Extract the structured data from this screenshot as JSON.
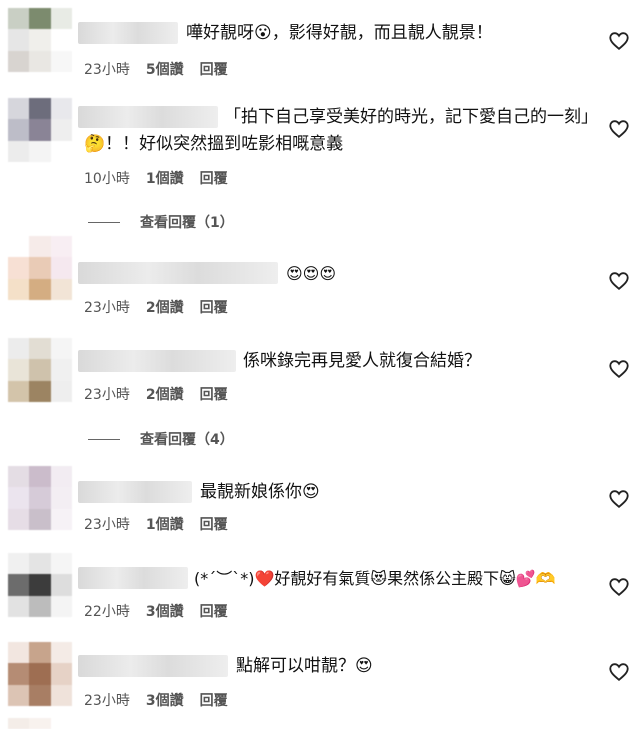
{
  "comments": [
    {
      "text": "嘩好靚呀😮，影得好靚，而且靚人靚景！",
      "time": "23小時",
      "likes": "5個讚",
      "reply": "回覆",
      "avatar": [
        "#c9cfc4",
        "#7c8b6e",
        "#e8ebe5",
        "#e6e6e6",
        "#f0efeb",
        "#ffffff",
        "#d8d4d0",
        "#e9e7e3",
        "#f7f7f7"
      ]
    },
    {
      "text": "「拍下自己享受美好的時光，記下愛自己的一刻」🤔！！好似突然搵到咗影相嘅意義",
      "time": "10小時",
      "likes": "1個讚",
      "reply": "回覆",
      "avatar": [
        "#d6d6dc",
        "#6d6d7c",
        "#e8e8ec",
        "#bdbdc8",
        "#8a8496",
        "#eeeeee",
        "#ececec",
        "#f4f4f4",
        "#ffffff"
      ]
    },
    {
      "text": "😍😍😍",
      "time": "23小時",
      "likes": "2個讚",
      "reply": "回覆",
      "avatar": [
        "#ffffff",
        "#f6ebe9",
        "#f8eef3",
        "#f7e0d4",
        "#e9cbb6",
        "#f5e8ef",
        "#f4e0c8",
        "#d4ad82",
        "#f2e4d6"
      ]
    },
    {
      "text": "係咪錄完再見愛人就復合結婚？",
      "time": "23小時",
      "likes": "2個讚",
      "reply": "回覆",
      "avatar": [
        "#ececec",
        "#e2ddd3",
        "#f5f5f5",
        "#e9e4d8",
        "#cfc2ac",
        "#f0f0f0",
        "#d3c4aa",
        "#9c8462",
        "#eeeeee"
      ]
    },
    {
      "text": "最靚新娘係你😍",
      "time": "23小時",
      "likes": "1個讚",
      "reply": "回覆",
      "avatar": [
        "#e4dde4",
        "#cbbccb",
        "#f2ecf2",
        "#ebe4ee",
        "#d6cbd8",
        "#f3eef3",
        "#e6dde6",
        "#c9bfca",
        "#f6f2f6"
      ]
    },
    {
      "text": "(*´︶`*)❤️好靚好有氣質😻果然係公主殿下😸💕🫶",
      "time": "22小時",
      "likes": "3個讚",
      "reply": "回覆",
      "avatar": [
        "#f0f0f0",
        "#e4e4e4",
        "#f5f5f5",
        "#6c6c6c",
        "#3c3c3c",
        "#dddddd",
        "#e2e2e2",
        "#bcbcbc",
        "#f4f4f4"
      ]
    },
    {
      "text": "點解可以咁靚？😍",
      "time": "23小時",
      "likes": "3個讚",
      "reply": "回覆",
      "avatar": [
        "#f2e6e0",
        "#c7a48c",
        "#f4ebe6",
        "#b58c74",
        "#9e6e52",
        "#e6d2c6",
        "#dcc4b4",
        "#a87e64",
        "#efe2da"
      ]
    }
  ],
  "view_replies": [
    {
      "label": "查看回覆（1）"
    },
    {
      "label": "查看回覆（4）"
    }
  ],
  "icons": {
    "like": "heart-outline-icon"
  }
}
